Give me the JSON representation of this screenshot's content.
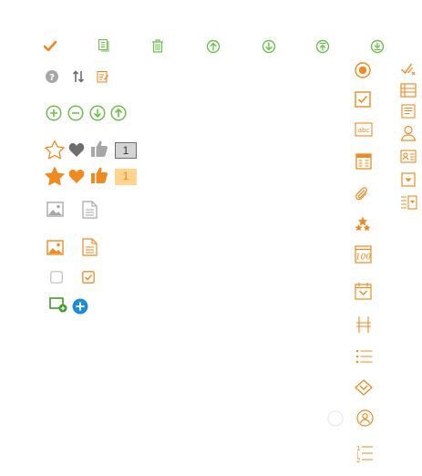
{
  "colors": {
    "orange": "#ee8a1e",
    "green": "#6cc04a",
    "dark_green": "#3e9b2a",
    "gray": "#a7a7a7",
    "dark_gray": "#6e6e6e",
    "blue": "#1c8ed6",
    "light_orange": "#ffd48f"
  },
  "rating": {
    "empty_count": "1",
    "filled_count": "1"
  },
  "icons": [
    "check-icon",
    "document-list-icon",
    "trash-icon",
    "arrow-up-circle-icon",
    "arrow-down-circle-icon",
    "upload-circle-icon",
    "download-circle-icon",
    "help-circle-icon",
    "sort-icon",
    "edit-note-icon",
    "add-circle-icon",
    "remove-circle-icon",
    "move-down-circle-icon",
    "move-up-circle-icon",
    "star-empty-icon",
    "heart-gray-icon",
    "thumbs-up-gray-icon",
    "star-filled-icon",
    "heart-orange-icon",
    "thumbs-up-orange-icon",
    "image-gray-icon",
    "document-gray-icon",
    "image-orange-icon",
    "document-orange-icon",
    "checkbox-empty-icon",
    "checkbox-checked-icon",
    "add-screen-icon",
    "add-circle-blue-icon",
    "radio-button-icon",
    "checkbox-field-icon",
    "text-field-icon",
    "table-field-icon",
    "attachment-icon",
    "rating-field-icon",
    "number-field-icon",
    "date-field-icon",
    "section-break-icon",
    "list-field-icon",
    "dropdown-field-icon",
    "user-field-icon",
    "sequence-icon",
    "approve-icon",
    "layout-icon",
    "paragraph-icon",
    "person-icon",
    "contact-card-icon",
    "dropdown-box-icon",
    "multi-select-icon"
  ]
}
